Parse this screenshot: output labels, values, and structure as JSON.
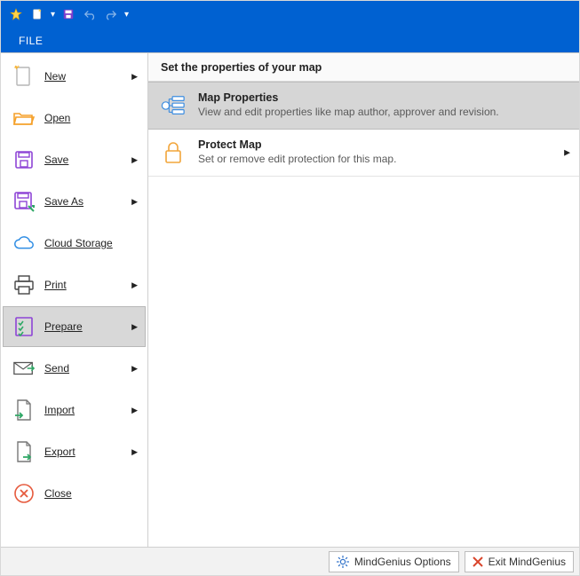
{
  "toolbar": {
    "file_tab": "FILE"
  },
  "sidebar": {
    "items": [
      {
        "label": "New",
        "submenu": true
      },
      {
        "label": "Open",
        "submenu": false
      },
      {
        "label": "Save",
        "submenu": true
      },
      {
        "label": "Save As",
        "submenu": true
      },
      {
        "label": "Cloud Storage",
        "submenu": false
      },
      {
        "label": "Print",
        "submenu": true
      },
      {
        "label": "Prepare",
        "submenu": true
      },
      {
        "label": "Send",
        "submenu": true
      },
      {
        "label": "Import",
        "submenu": true
      },
      {
        "label": "Export",
        "submenu": true
      },
      {
        "label": "Close",
        "submenu": false
      }
    ]
  },
  "content": {
    "header": "Set the properties of your map",
    "items": [
      {
        "title": "Map Properties",
        "desc": "View and edit properties like map author, approver and revision.",
        "submenu": false
      },
      {
        "title": "Protect Map",
        "desc": "Set or remove edit protection for this map.",
        "submenu": true
      }
    ]
  },
  "footer": {
    "options": "MindGenius Options",
    "exit": "Exit MindGenius"
  }
}
